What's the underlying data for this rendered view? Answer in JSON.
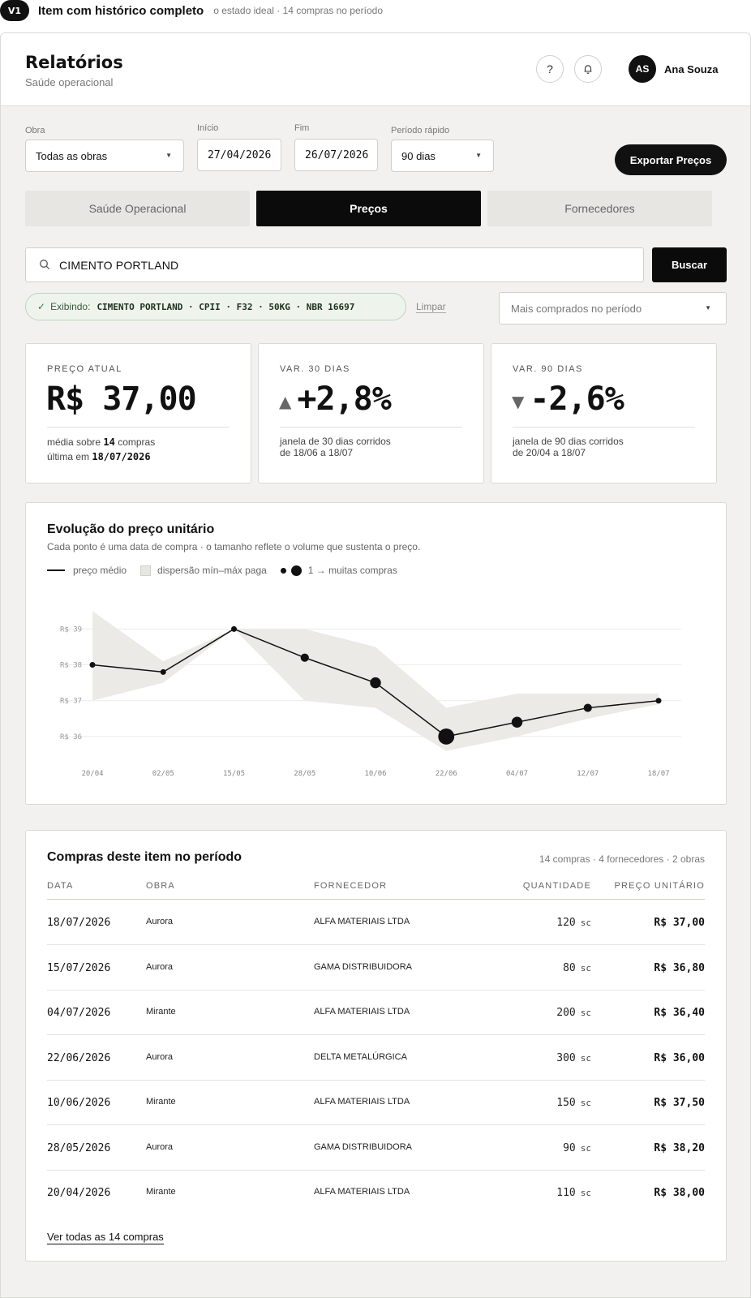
{
  "variant": {
    "badge": "V1",
    "title": "Item com histórico completo",
    "subtitle": "o estado ideal · 14 compras no período"
  },
  "header": {
    "title": "Relatórios",
    "subtitle": "Saúde operacional",
    "help_icon": "?",
    "notification_icon": "bell-icon",
    "user_initials": "AS",
    "user_name": "Ana Souza"
  },
  "filters": {
    "obra_label": "Obra",
    "obra_value": "Todas as obras",
    "inicio_label": "Início",
    "inicio_value": "27/04/2026",
    "fim_label": "Fim",
    "fim_value": "26/07/2026",
    "periodo_label": "Período rápido",
    "periodo_value": "90 dias",
    "export_label": "Exportar Preços"
  },
  "tabs": [
    {
      "label": "Saúde Operacional",
      "active": false
    },
    {
      "label": "Preços",
      "active": true
    },
    {
      "label": "Fornecedores",
      "active": false
    }
  ],
  "search": {
    "value": "CIMENTO PORTLAND",
    "button_label": "Buscar"
  },
  "selection": {
    "prefix": "Exibindo:",
    "item": "CIMENTO PORTLAND · CPII · F32 · 50KG · NBR 16697",
    "clear_label": "Limpar",
    "sort_value": "Mais comprados no período"
  },
  "kpis": {
    "current": {
      "label": "PREÇO ATUAL",
      "value": "R$ 37,00",
      "note_prefix": "média sobre",
      "note_count": "14",
      "note_suffix": "compras",
      "last_prefix": "última em",
      "last_date": "18/07/2026"
    },
    "var30": {
      "label": "VAR. 30 DIAS",
      "direction": "up",
      "value": "+2,8%",
      "note1": "janela de 30 dias corridos",
      "note2": "de 18/06 a 18/07"
    },
    "var90": {
      "label": "VAR. 90 DIAS",
      "direction": "down",
      "value": "-2,6%",
      "note1": "janela de 90 dias corridos",
      "note2": "de 20/04 a 18/07"
    }
  },
  "chart": {
    "title": "Evolução do preço unitário",
    "subtitle": "Cada ponto é uma data de compra · o tamanho reflete o volume que sustenta o preço.",
    "legend_line": "preço médio",
    "legend_band": "dispersão mín–máx paga",
    "legend_dots": "1 → muitas compras"
  },
  "chart_data": {
    "type": "line",
    "title": "Evolução do preço unitário",
    "x": [
      "20/04",
      "02/05",
      "15/05",
      "28/05",
      "10/06",
      "22/06",
      "04/07",
      "12/07",
      "18/07"
    ],
    "series": [
      {
        "name": "preço médio",
        "values": [
          38.0,
          37.8,
          39.0,
          38.2,
          37.5,
          36.0,
          36.4,
          36.8,
          37.0
        ]
      },
      {
        "name": "dispersão mín–máx paga (mín)",
        "values": [
          37.0,
          37.5,
          39.0,
          37.0,
          36.8,
          35.6,
          36.0,
          36.5,
          36.9
        ]
      },
      {
        "name": "dispersão mín–máx paga (máx)",
        "values": [
          39.5,
          38.1,
          39.0,
          39.0,
          38.5,
          36.8,
          37.2,
          37.2,
          37.2
        ]
      }
    ],
    "purchases": [
      1,
      1,
      1,
      2,
      3,
      5,
      3,
      2,
      1
    ],
    "y_ticks": [
      "R$ 36",
      "R$ 37",
      "R$ 38",
      "R$ 39"
    ],
    "ylim": [
      35.5,
      39.8
    ],
    "grid": true,
    "colors": {
      "line": "#111111",
      "band": "#ebeae6",
      "grid": "#ececea"
    }
  },
  "table": {
    "title": "Compras deste item no período",
    "summary": "14 compras · 4 fornecedores · 2 obras",
    "headers": {
      "data": "DATA",
      "obra": "OBRA",
      "fornecedor": "FORNECEDOR",
      "quantidade": "QUANTIDADE",
      "preco": "PREÇO UNITÁRIO"
    },
    "rows": [
      {
        "data": "18/07/2026",
        "obra": "Aurora",
        "fornecedor": "ALFA MATERIAIS LTDA",
        "qtd": "120",
        "unit": "sc",
        "preco": "R$ 37,00"
      },
      {
        "data": "15/07/2026",
        "obra": "Aurora",
        "fornecedor": "GAMA DISTRIBUIDORA",
        "qtd": "80",
        "unit": "sc",
        "preco": "R$ 36,80"
      },
      {
        "data": "04/07/2026",
        "obra": "Mirante",
        "fornecedor": "ALFA MATERIAIS LTDA",
        "qtd": "200",
        "unit": "sc",
        "preco": "R$ 36,40"
      },
      {
        "data": "22/06/2026",
        "obra": "Aurora",
        "fornecedor": "DELTA METALÚRGICA",
        "qtd": "300",
        "unit": "sc",
        "preco": "R$ 36,00"
      },
      {
        "data": "10/06/2026",
        "obra": "Mirante",
        "fornecedor": "ALFA MATERIAIS LTDA",
        "qtd": "150",
        "unit": "sc",
        "preco": "R$ 37,50"
      },
      {
        "data": "28/05/2026",
        "obra": "Aurora",
        "fornecedor": "GAMA DISTRIBUIDORA",
        "qtd": "90",
        "unit": "sc",
        "preco": "R$ 38,20"
      },
      {
        "data": "20/04/2026",
        "obra": "Mirante",
        "fornecedor": "ALFA MATERIAIS LTDA",
        "qtd": "110",
        "unit": "sc",
        "preco": "R$ 38,00"
      }
    ],
    "see_all": "Ver todas as 14 compras"
  }
}
